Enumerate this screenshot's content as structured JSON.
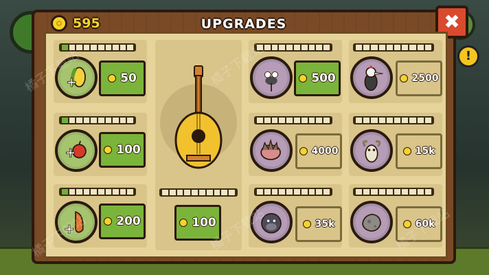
{
  "header": {
    "title": "UPGRADES",
    "coins": "595"
  },
  "close": {
    "label": "✖"
  },
  "hud": {
    "alert": "!"
  },
  "center": {
    "price": "100",
    "progress": 0
  },
  "cards": [
    {
      "id": "corn",
      "price": "50",
      "locked": false,
      "progress": 1
    },
    {
      "id": "apple",
      "price": "100",
      "locked": false,
      "progress": 1
    },
    {
      "id": "carrot",
      "price": "200",
      "locked": false,
      "progress": 1
    },
    {
      "id": "mosquito",
      "price": "500",
      "locked": false,
      "progress": 0
    },
    {
      "id": "woodpecker",
      "price": "2500",
      "locked": true,
      "progress": 0
    },
    {
      "id": "hedgehog",
      "price": "4000",
      "locked": true,
      "progress": 0
    },
    {
      "id": "goat",
      "price": "15k",
      "locked": true,
      "progress": 0
    },
    {
      "id": "gorilla",
      "price": "35k",
      "locked": true,
      "progress": 0
    },
    {
      "id": "rock",
      "price": "60k",
      "locked": true,
      "progress": 0
    }
  ],
  "watermark": "橘子下载站",
  "colors": {
    "buy": "#7bb43a",
    "panel": "#7a4a26",
    "coin": "#f6d32b",
    "close": "#d94a2f"
  }
}
